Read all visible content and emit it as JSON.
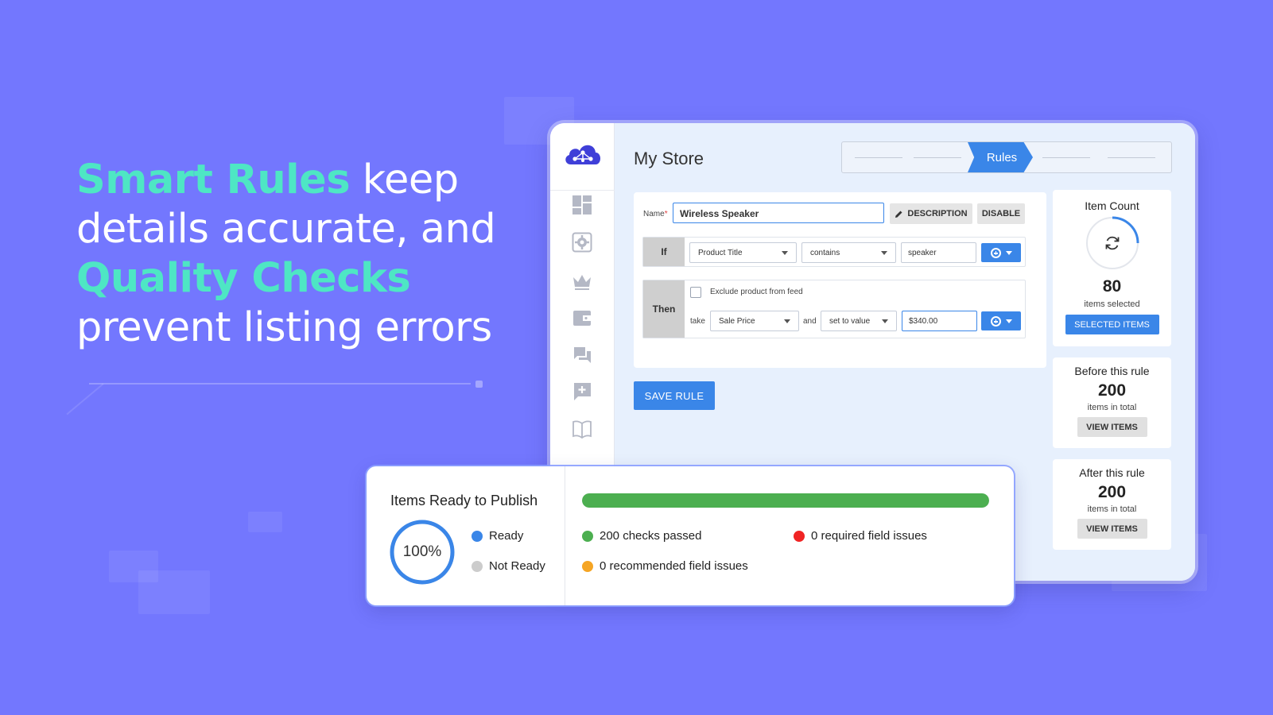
{
  "headline": {
    "part1": "Smart Rules",
    "part2": " keep details accurate, and ",
    "part3": "Quality Checks",
    "part4": " prevent listing errors"
  },
  "app": {
    "store_title": "My Store",
    "stepper": {
      "active_step": "Rules"
    },
    "sidebar_icons": [
      "dashboard-icon",
      "settings-icon",
      "crown-icon",
      "wallet-icon",
      "chat-icon",
      "add-comment-icon",
      "book-icon"
    ],
    "rule": {
      "name_label": "Name",
      "name_required_mark": "*",
      "name_value": "Wireless Speaker",
      "description_button": "DESCRIPTION",
      "disable_button": "DISABLE",
      "if_label": "If",
      "if_field": "Product Title",
      "if_operator": "contains",
      "if_value": "speaker",
      "then_label": "Then",
      "exclude_label": "Exclude product from feed",
      "take_label": "take",
      "then_field": "Sale Price",
      "and_label": "and",
      "then_action": "set to value",
      "then_value": "$340.00"
    },
    "save_button": "SAVE RULE",
    "item_count": {
      "title": "Item Count",
      "value": "80",
      "subtitle": "items selected",
      "button": "SELECTED ITEMS"
    },
    "before_rule": {
      "title": "Before this rule",
      "value": "200",
      "subtitle": "items in total",
      "button": "VIEW ITEMS"
    },
    "after_rule": {
      "title": "After this rule",
      "value": "200",
      "subtitle": "items in total",
      "button": "VIEW ITEMS"
    }
  },
  "publish": {
    "title": "Items Ready to Publish",
    "percent_label": "100%",
    "ready_fraction": 1.0,
    "legend_ready": "Ready",
    "legend_not_ready": "Not Ready",
    "progress_fraction": 1.0,
    "checks_passed": "200 checks passed",
    "required_issues": "0 required field issues",
    "recommended_issues": "0 recommended field issues"
  },
  "colors": {
    "background": "#7377fe",
    "accent_text": "#4ee6c4",
    "primary": "#3a86e8",
    "success": "#4caf50",
    "error": "#f02424",
    "warning": "#f5a524",
    "not_ready": "#cccccc"
  }
}
